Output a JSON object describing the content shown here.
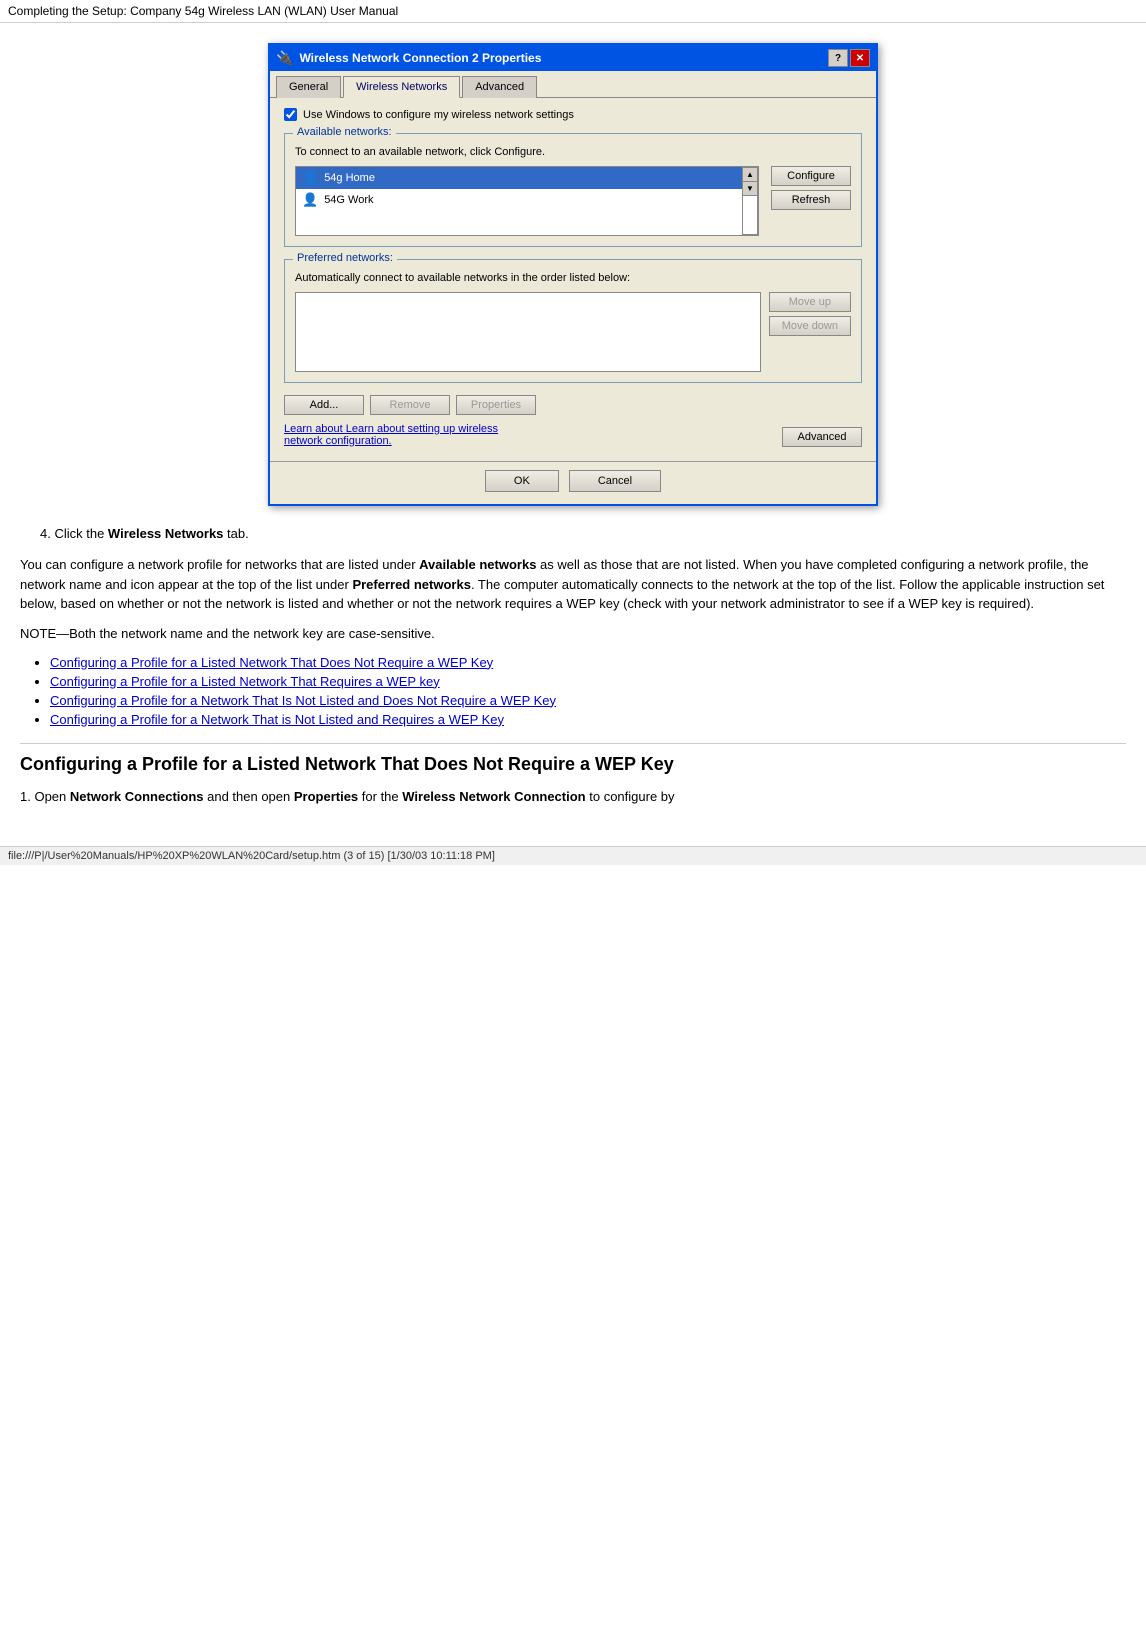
{
  "browser": {
    "title": "Completing the Setup: Company 54g Wireless LAN (WLAN) User Manual"
  },
  "dialog": {
    "title": "Wireless Network Connection 2 Properties",
    "title_icon": "🔌",
    "tabs": [
      {
        "label": "General",
        "active": false
      },
      {
        "label": "Wireless Networks",
        "active": true
      },
      {
        "label": "Advanced",
        "active": false
      }
    ],
    "checkbox_label": "Use Windows to configure my wireless network settings",
    "available_networks_label": "Available networks:",
    "available_networks_desc": "To connect to an available network, click Configure.",
    "networks": [
      {
        "name": "54g Home",
        "selected": true
      },
      {
        "name": "54G Work",
        "selected": false
      }
    ],
    "configure_btn": "Configure",
    "refresh_btn": "Refresh",
    "preferred_networks_label": "Preferred networks:",
    "preferred_desc": "Automatically connect to available networks in the order listed below:",
    "move_up_btn": "Move up",
    "move_down_btn": "Move down",
    "add_btn": "Add...",
    "remove_btn": "Remove",
    "properties_btn": "Properties",
    "learn_text": "Learn about setting up wireless network configuration.",
    "advanced_btn": "Advanced",
    "ok_btn": "OK",
    "cancel_btn": "Cancel",
    "titlebar_btns": {
      "help": "?",
      "close": "✕"
    }
  },
  "content": {
    "step4": "4.  Click the ",
    "step4_bold": "Wireless Networks",
    "step4_end": " tab.",
    "paragraph1": "You can configure a network profile for networks that are listed under ",
    "paragraph1_bold": "Available networks",
    "paragraph1_cont": " as well as those that are not listed. When you have completed configuring a network profile, the network name and icon appear at the top of the list under ",
    "paragraph1_bold2": "Preferred networks",
    "paragraph1_cont2": ". The computer automatically connects to the network at the top of the list. Follow the applicable instruction set below, based on whether or not the network is listed and whether or not the network requires a WEP key (check with your network administrator to see if a WEP key is required).",
    "note": "NOTE—Both the network name and the network key are case-sensitive.",
    "bullets": [
      "Configuring a Profile for a Listed Network That Does Not Require a WEP Key",
      "Configuring a Profile for a Listed Network That Requires a WEP key",
      "Configuring a Profile for a Network That Is Not Listed and Does Not Require a WEP Key",
      "Configuring a Profile for a Network That is Not Listed and Requires a WEP Key"
    ],
    "section_heading": "Configuring a Profile for a Listed Network That Does Not Require a WEP Key",
    "step1": "1.  Open ",
    "step1_bold": "Network Connections",
    "step1_cont": " and then open ",
    "step1_bold2": "Properties",
    "step1_cont2": " for the ",
    "step1_bold3": "Wireless Network Connection",
    "step1_end": " to configure by"
  },
  "status_bar": {
    "text": "file:///P|/User%20Manuals/HP%20XP%20WLAN%20Card/setup.htm (3 of 15) [1/30/03 10:11:18 PM]"
  }
}
